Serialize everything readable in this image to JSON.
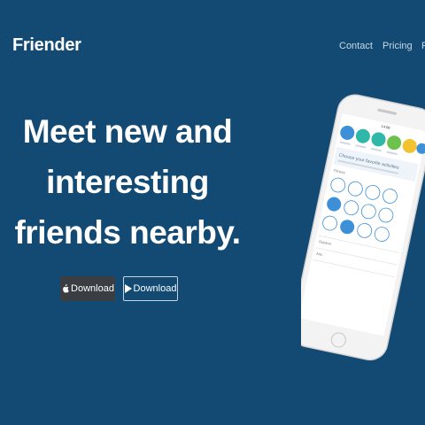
{
  "header": {
    "brand": "Friender",
    "nav": [
      {
        "label": "Contact"
      },
      {
        "label": "Pricing"
      },
      {
        "label": "F"
      }
    ]
  },
  "hero": {
    "lines": [
      "Meet new and",
      "interesting",
      "friends nearby."
    ]
  },
  "buttons": {
    "apple_label": "Download",
    "play_label": "Download"
  },
  "phone_screen": {
    "title": "Choose your favorite activities",
    "section1": "Fitness",
    "section2": "Outdoor",
    "section3": "Arts",
    "colors": {
      "teal": "#2fb8a8",
      "green": "#6cc24a",
      "yellow": "#f2c230",
      "blue": "#3d8fd8",
      "phone_body": "#f4f4f4"
    }
  }
}
